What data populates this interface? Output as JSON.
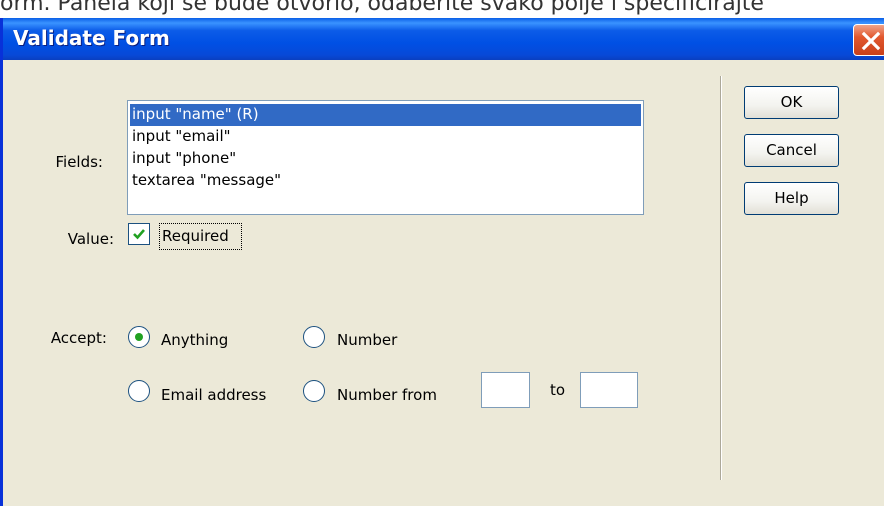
{
  "background": {
    "caption": "orm. Panela koji se bude otvorio, odaberite svako polje i specificirajte"
  },
  "dialog": {
    "title": "Validate Form",
    "close_icon": "close-x-icon"
  },
  "fields": {
    "label": "Fields:",
    "items": [
      "input \"name\" (R)",
      "input \"email\"",
      "input \"phone\"",
      "textarea \"message\""
    ],
    "selected_index": 0
  },
  "value": {
    "label": "Value:",
    "required_label": "Required",
    "required_checked": true
  },
  "accept": {
    "label": "Accept:",
    "options": {
      "anything": "Anything",
      "number": "Number",
      "email": "Email address",
      "number_from": "Number from"
    },
    "selected": "anything",
    "range_to_label": "to",
    "range_from_value": "",
    "range_to_value": ""
  },
  "buttons": {
    "ok": "OK",
    "cancel": "Cancel",
    "help": "Help"
  },
  "colors": {
    "titlebar": "#0050e4",
    "dialog_bg": "#ece9d8",
    "selection": "#316ac5",
    "radio_dot": "#21a121",
    "close_button": "#e2582e"
  }
}
